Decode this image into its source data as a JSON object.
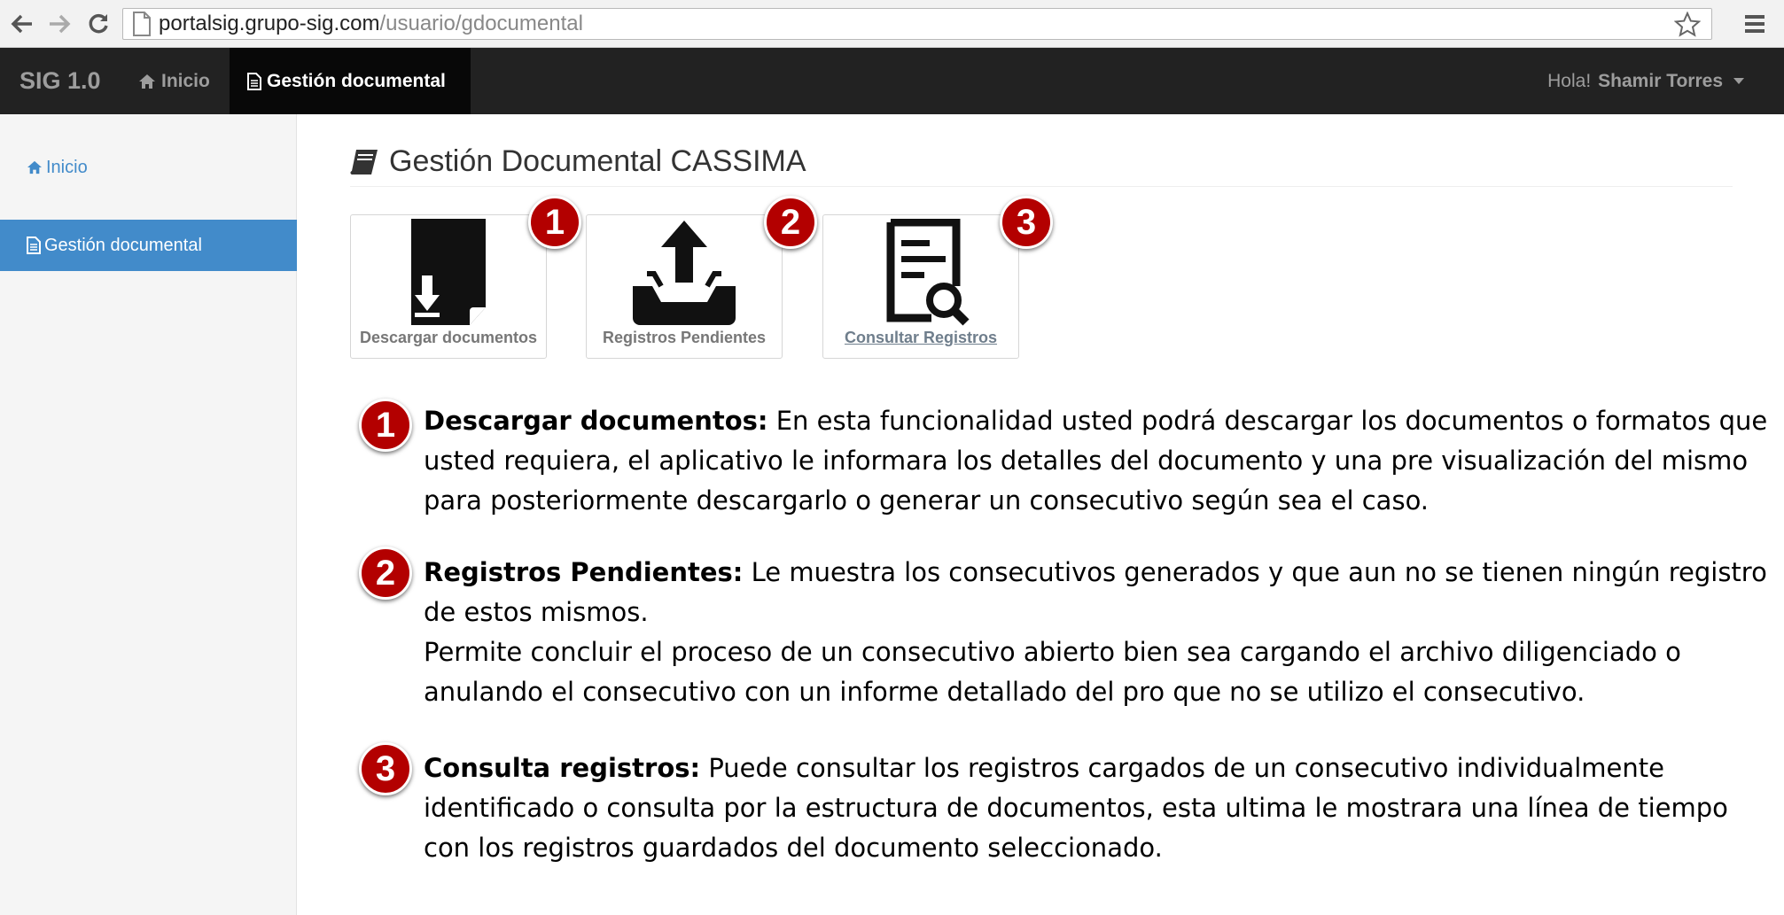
{
  "browser": {
    "url_domain": "portalsig.grupo-sig.com",
    "url_path": "/usuario/gdocumental"
  },
  "navbar": {
    "brand": "SIG 1.0",
    "items": [
      {
        "label": "Inicio",
        "icon": "home-icon"
      },
      {
        "label": "Gestión documental",
        "icon": "document-icon"
      }
    ],
    "greeting": "Hola!",
    "user_name": "Shamir Torres"
  },
  "sidebar": {
    "items": [
      {
        "label": "Inicio",
        "icon": "home-icon"
      },
      {
        "label": "Gestión documental",
        "icon": "document-icon"
      }
    ]
  },
  "main": {
    "title": "Gestión Documental CASSIMA",
    "tiles": [
      {
        "label": "Descargar documentos",
        "badge": "1",
        "icon": "download-document-icon"
      },
      {
        "label": "Registros Pendientes",
        "badge": "2",
        "icon": "upload-tray-icon"
      },
      {
        "label": "Consultar Registros",
        "badge": "3",
        "icon": "search-document-icon"
      }
    ],
    "descriptions": [
      {
        "badge": "1",
        "heading": "Descargar documentos:",
        "text": " En esta funcionalidad usted podrá descargar los documentos o formatos que usted requiera, el aplicativo le informara los detalles del documento y una pre visualización del mismo para posteriormente descargarlo o generar un consecutivo según sea el caso."
      },
      {
        "badge": "2",
        "heading": "Registros Pendientes:",
        "text": " Le muestra los consecutivos generados y que aun no se tienen ningún registro de estos mismos.",
        "text2": "Permite concluir el proceso de un consecutivo abierto bien sea cargando el archivo diligenciado o anulando el consecutivo con un informe detallado del pro que no se utilizo el consecutivo."
      },
      {
        "badge": "3",
        "heading": "Consulta registros:",
        "text": " Puede consultar los registros cargados de un consecutivo individualmente identificado o consulta por la estructura de documentos, esta ultima le mostrara una línea de tiempo con los registros guardados del documento seleccionado."
      }
    ]
  },
  "colors": {
    "navbar_bg": "#222222",
    "active_blue": "#428bca",
    "badge_red": "#b30000"
  }
}
